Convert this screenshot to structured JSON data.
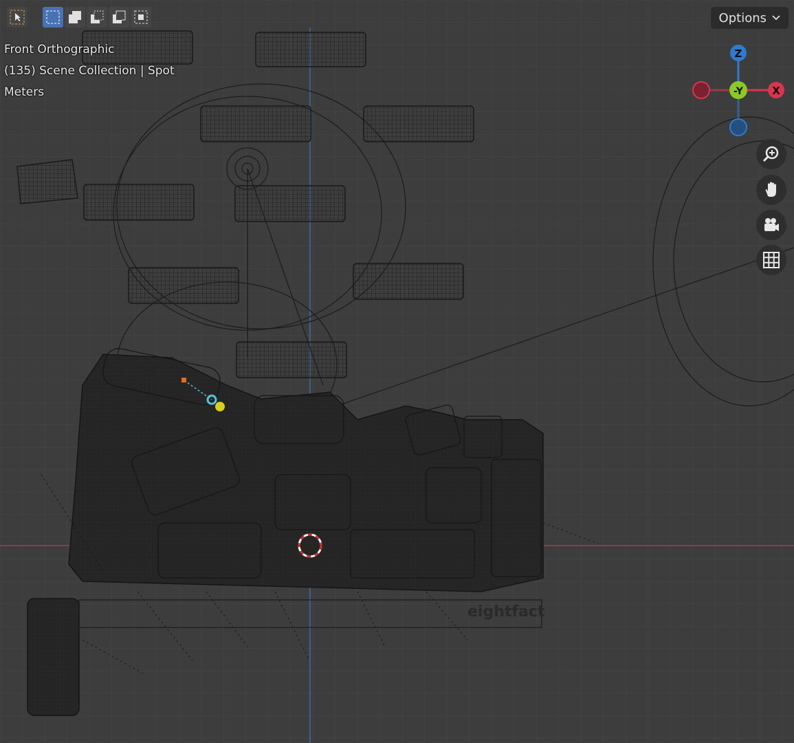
{
  "viewport": {
    "view_name": "Front Orthographic",
    "collection_info": "(135) Scene Collection | Spot",
    "units": "Meters",
    "watermark": "eightfact"
  },
  "header": {
    "tools": [
      {
        "name": "select-tool",
        "icon": "cursor-arrow-icon"
      },
      {
        "name": "box-select-new",
        "icon": "box-select-new-icon",
        "active": true
      },
      {
        "name": "box-select-extend",
        "icon": "box-select-extend-icon"
      },
      {
        "name": "box-select-subtract",
        "icon": "box-select-subtract-icon"
      },
      {
        "name": "box-select-invert",
        "icon": "box-select-invert-icon"
      },
      {
        "name": "box-select-intersect",
        "icon": "box-select-intersect-icon"
      }
    ],
    "options_label": "Options"
  },
  "gizmo": {
    "z_label": "Z",
    "y_label": "-Y",
    "x_label": "X"
  },
  "nav_buttons": [
    "zoom-icon",
    "hand-pan-icon",
    "camera-icon",
    "grid-icon"
  ],
  "colors": {
    "background": "#3d3d3d",
    "grid_minor": "#474747",
    "x_axis": "#b5354b",
    "z_axis": "#3a6ea8",
    "gizmo_x": "#d9354f",
    "gizmo_y": "#8ac926",
    "gizmo_z": "#2e7ad1",
    "active_tool": "#4772b3"
  }
}
